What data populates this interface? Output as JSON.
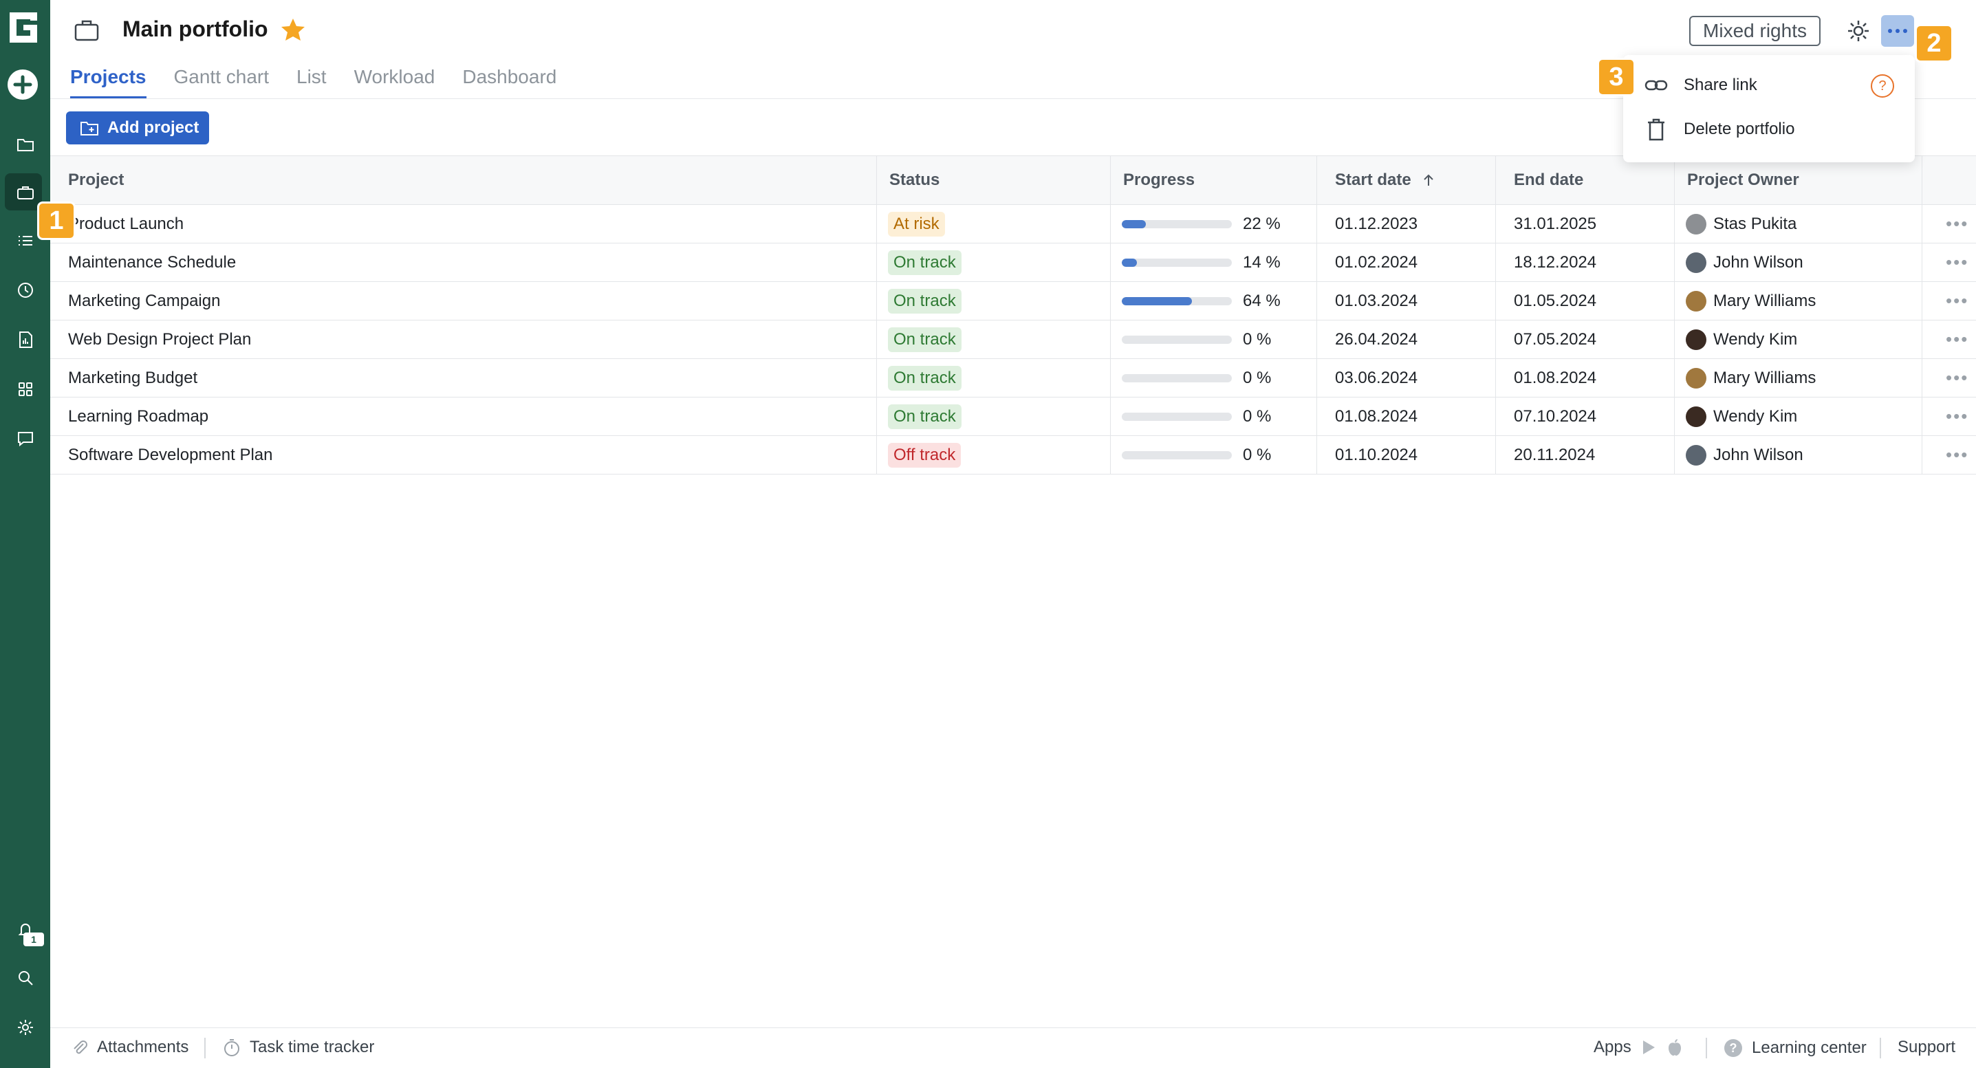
{
  "header": {
    "title": "Main portfolio",
    "rights_label": "Mixed rights",
    "star_icon": "star-icon",
    "star_color": "#f5a623"
  },
  "tabs": [
    {
      "label": "Projects",
      "active": true
    },
    {
      "label": "Gantt chart"
    },
    {
      "label": "List"
    },
    {
      "label": "Workload"
    },
    {
      "label": "Dashboard"
    }
  ],
  "toolbar": {
    "add_project_label": "Add project"
  },
  "table": {
    "columns": [
      "Project",
      "Status",
      "Progress",
      "Start date",
      "End date",
      "Project Owner"
    ],
    "rows": [
      {
        "project": "Product Launch",
        "status": "At risk",
        "progress": 22,
        "progress_label": "22 %",
        "start": "01.12.2023",
        "end": "31.01.2025",
        "owner": "Stas Pukita"
      },
      {
        "project": "Maintenance Schedule",
        "status": "On track",
        "progress": 14,
        "progress_label": "14 %",
        "start": "01.02.2024",
        "end": "18.12.2024",
        "owner": "John Wilson"
      },
      {
        "project": "Marketing Campaign",
        "status": "On track",
        "progress": 64,
        "progress_label": "64 %",
        "start": "01.03.2024",
        "end": "01.05.2024",
        "owner": "Mary Williams"
      },
      {
        "project": "Web Design Project Plan",
        "status": "On track",
        "progress": 0,
        "progress_label": "0 %",
        "start": "26.04.2024",
        "end": "07.05.2024",
        "owner": "Wendy Kim"
      },
      {
        "project": "Marketing Budget",
        "status": "On track",
        "progress": 0,
        "progress_label": "0 %",
        "start": "03.06.2024",
        "end": "01.08.2024",
        "owner": "Mary Williams"
      },
      {
        "project": "Learning Roadmap",
        "status": "On track",
        "progress": 0,
        "progress_label": "0 %",
        "start": "01.08.2024",
        "end": "07.10.2024",
        "owner": "Wendy Kim"
      },
      {
        "project": "Software Development Plan",
        "status": "Off track",
        "progress": 0,
        "progress_label": "0 %",
        "start": "01.10.2024",
        "end": "20.11.2024",
        "owner": "John Wilson"
      }
    ]
  },
  "menu": {
    "share_link": "Share link",
    "delete_portfolio": "Delete portfolio",
    "help_glyph": "?"
  },
  "steps": [
    "1",
    "2",
    "3"
  ],
  "sidebar": {
    "notification_count": "1"
  },
  "footer": {
    "attachments": "Attachments",
    "time_tracker": "Task time tracker",
    "apps": "Apps",
    "learning_center": "Learning center",
    "support": "Support"
  },
  "colors": {
    "sidebar": "#1f5a47",
    "accent": "#2f62c8",
    "step_marker": "#f5a623",
    "at_risk": "#b26a00",
    "on_track": "#2e7a33",
    "off_track": "#c0282c"
  }
}
